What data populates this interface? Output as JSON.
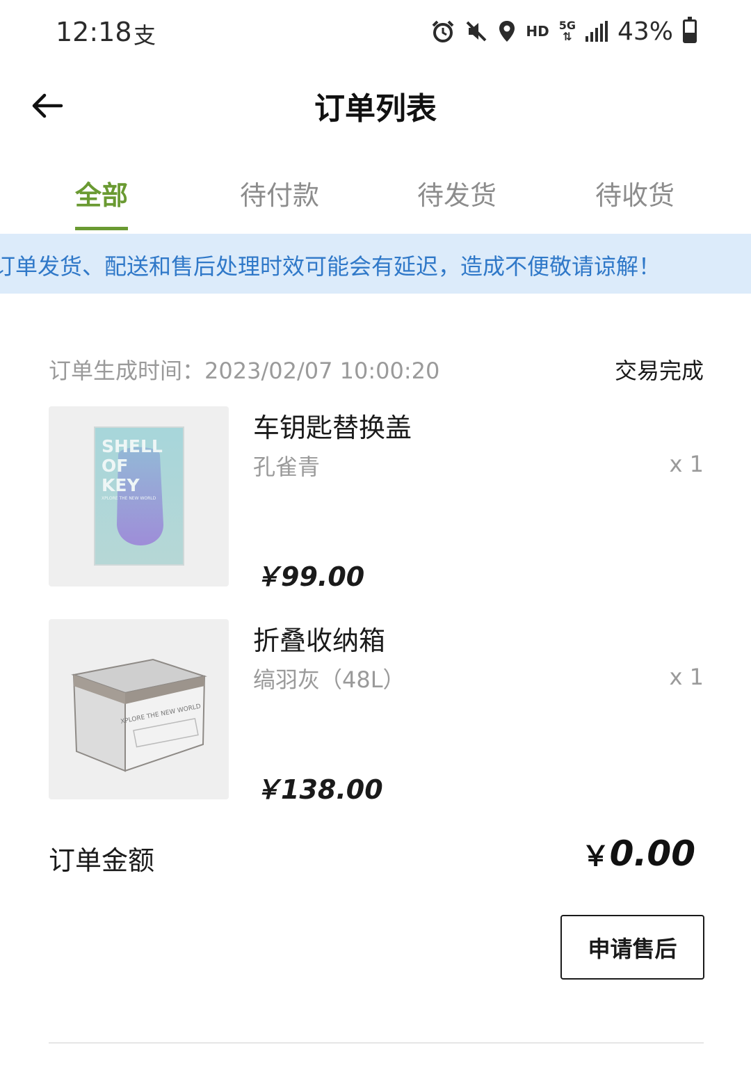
{
  "status_bar": {
    "time": "12:18",
    "extra_icon": "支",
    "hd": "HD",
    "network": "5G",
    "battery": "43%",
    "battery_level": 0.43,
    "icons": [
      "alarm-icon",
      "mute-icon",
      "location-icon",
      "signal-icon",
      "battery-icon"
    ]
  },
  "header": {
    "title": "订单列表",
    "back_icon": "back-arrow-icon"
  },
  "tabs": [
    {
      "label": "全部",
      "active": true
    },
    {
      "label": "待付款",
      "active": false
    },
    {
      "label": "待发货",
      "active": false
    },
    {
      "label": "待收货",
      "active": false
    }
  ],
  "notice": "订单发货、配送和售后处理时效可能会有延迟，造成不便敬请谅解！",
  "order": {
    "time_label": "订单生成时间：2023/02/07 10:00:20",
    "status": "交易完成",
    "items": [
      {
        "name": "车钥匙替换盖",
        "spec": "孔雀青",
        "qty": "x 1",
        "price": "￥99.00",
        "image": "SHELL OF KEY"
      },
      {
        "name": "折叠收纳箱",
        "spec": "缟羽灰（48L）",
        "qty": "x 1",
        "price": "￥138.00",
        "image": "XPLORE THE NEW WORLD"
      }
    ],
    "total_label": "订单金额",
    "total_currency": "￥",
    "total_value": "0.00",
    "action_button": "申请售后"
  },
  "colors": {
    "accent": "#6a9a32",
    "notice_bg": "#dcebfa",
    "notice_text": "#2f78c8"
  }
}
